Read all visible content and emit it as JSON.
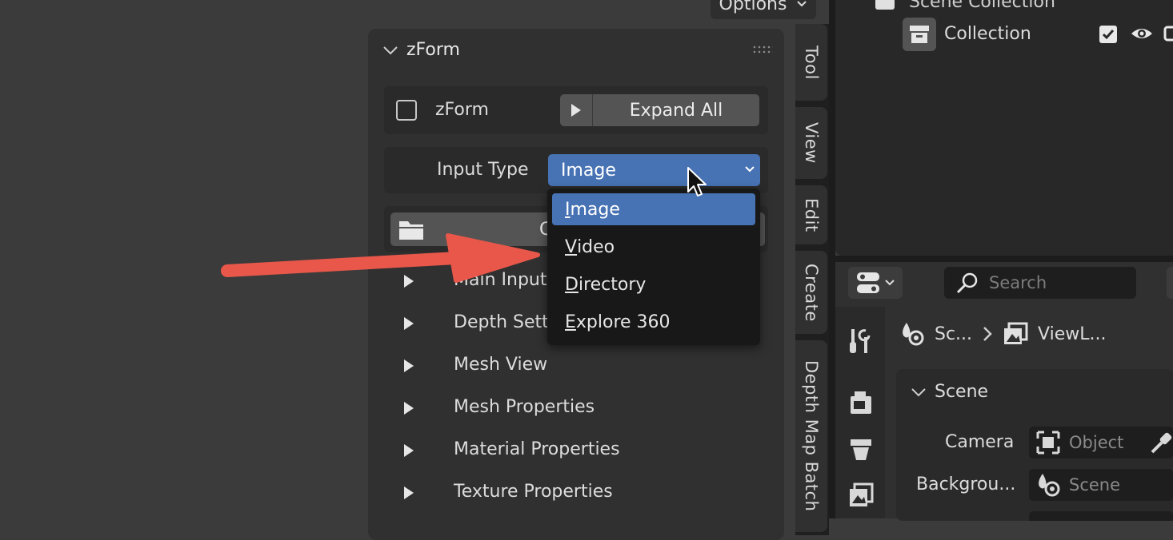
{
  "header": {
    "options_label": "Options"
  },
  "panel": {
    "title": "zForm",
    "enable_label": "zForm",
    "expand_all_label": "Expand All",
    "input_type_label": "Input Type",
    "input_type_value": "Image",
    "folder_button_visible_text": "C",
    "sections": [
      {
        "label": "Main Input"
      },
      {
        "label": "Depth Setti"
      },
      {
        "label": "Mesh View"
      },
      {
        "label": "Mesh Properties"
      },
      {
        "label": "Material Properties"
      },
      {
        "label": "Texture Properties"
      }
    ]
  },
  "dropdown": {
    "items": [
      {
        "first": "I",
        "rest": "mage",
        "selected": true
      },
      {
        "first": "V",
        "rest": "ideo",
        "selected": false
      },
      {
        "first": "D",
        "rest": "irectory",
        "selected": false
      },
      {
        "first": "E",
        "rest": "xplore 360",
        "selected": false
      }
    ]
  },
  "vertical_tabs": [
    "Tool",
    "View",
    "Edit",
    "Create",
    "Depth Map Batch"
  ],
  "outliner": {
    "scene_collection": "Scene Collection",
    "collection": "Collection"
  },
  "properties": {
    "search_placeholder": "Search",
    "breadcrumb_scene": "Sc...",
    "breadcrumb_viewlayer": "ViewL...",
    "section_title": "Scene",
    "camera_label": "Camera",
    "camera_value": "Object",
    "background_label": "Backgrou...",
    "background_value": "Scene"
  },
  "colors": {
    "accent_blue": "#4772b3",
    "arrow_red": "#e8574a"
  }
}
